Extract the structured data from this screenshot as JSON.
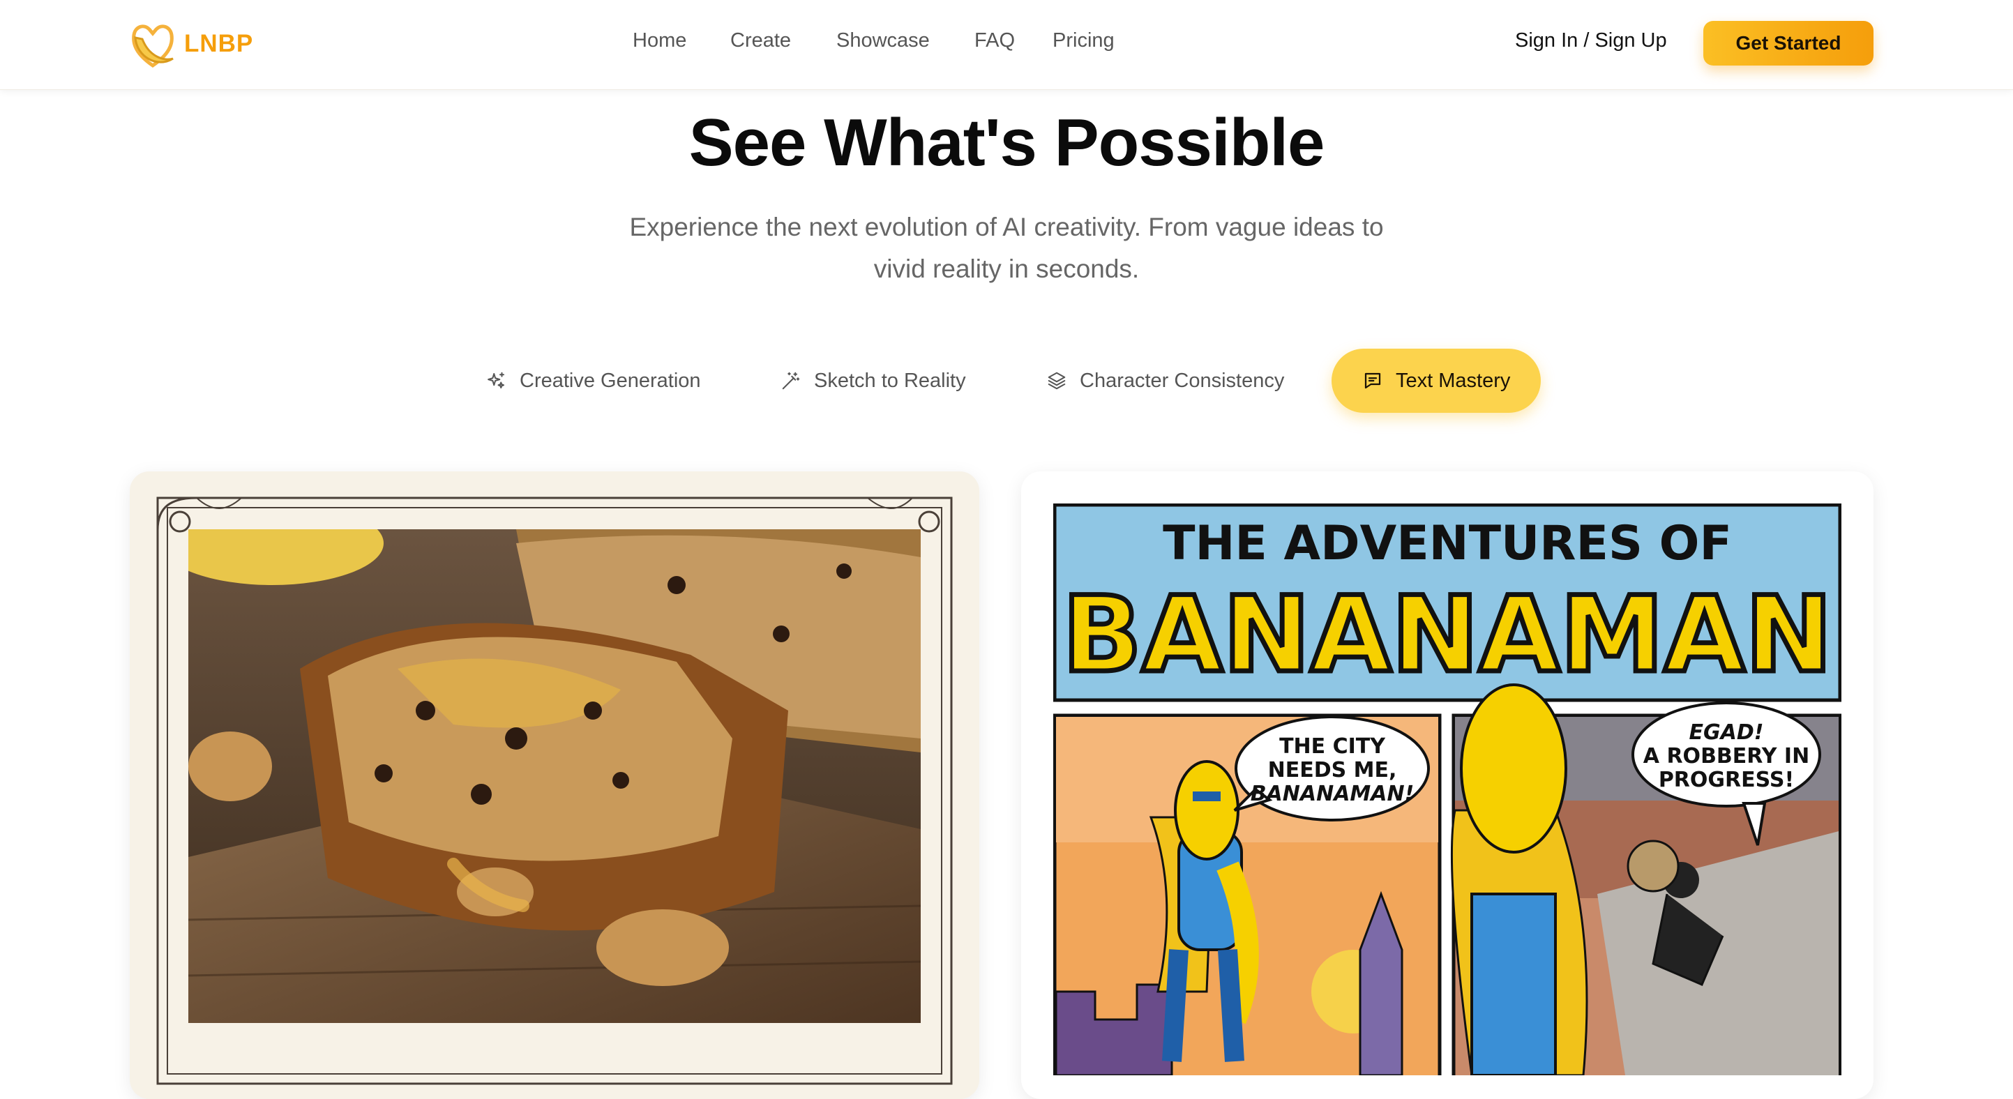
{
  "brand": {
    "name": "LNBP",
    "logo_icon": "banana-heart-logo-icon",
    "color": "#f59e0b"
  },
  "nav": {
    "links": [
      "Home",
      "Create",
      "Showcase",
      "FAQ",
      "Pricing"
    ],
    "sign_in": "Sign In / Sign Up",
    "cta": "Get Started"
  },
  "hero": {
    "title": "See What's Possible",
    "subtitle_line1": "Experience the next evolution of AI creativity. From vague ideas to",
    "subtitle_line2": "vivid reality in seconds."
  },
  "tabs": [
    {
      "label": "Creative Generation",
      "icon": "sparkles-icon",
      "active": false
    },
    {
      "label": "Sketch to Reality",
      "icon": "magic-wand-icon",
      "active": false
    },
    {
      "label": "Character Consistency",
      "icon": "layers-icon",
      "active": false
    },
    {
      "label": "Text Mastery",
      "icon": "chat-bubble-icon",
      "active": true
    }
  ],
  "showcase": {
    "left": {
      "subject": "banana-bread-photo"
    },
    "right": {
      "comic_title_top": "THE ADVENTURES OF",
      "comic_title_main": "BANANAMAN",
      "bubble1": [
        "THE CITY",
        "NEEDS ME,",
        "BANANAMAN!"
      ],
      "bubble2": [
        "EGAD!",
        "A ROBBERY IN",
        "PROGRESS!"
      ]
    }
  },
  "colors": {
    "accent": "#fbbf24",
    "accent_active": "#fcd34d",
    "text_muted": "#666666"
  }
}
